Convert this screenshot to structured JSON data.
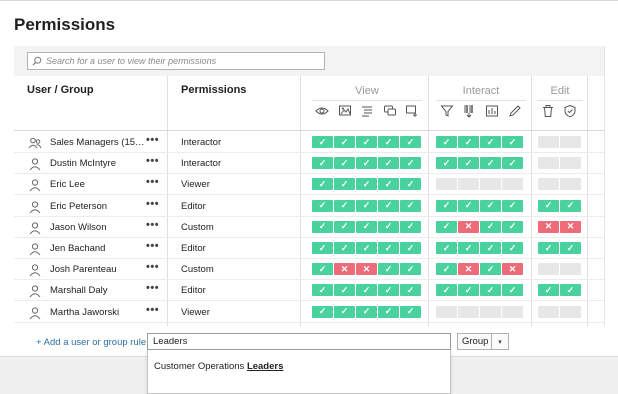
{
  "title": "Permissions",
  "search": {
    "placeholder": "Search for a user to view their permissions"
  },
  "headers": {
    "user_group": "User / Group",
    "permissions": "Permissions"
  },
  "capability_groups": [
    {
      "label": "View",
      "icons": [
        "eye-icon",
        "image-icon",
        "list-icon",
        "comment-icon",
        "subscribe-icon"
      ]
    },
    {
      "label": "Interact",
      "icons": [
        "filter-icon",
        "barcode-icon",
        "chart-download-icon",
        "pencil-icon"
      ]
    },
    {
      "label": "Edit",
      "icons": [
        "trash-icon",
        "shield-check-icon"
      ]
    }
  ],
  "rows": [
    {
      "name": "Sales Managers (15…",
      "is_group": true,
      "role": "Interactor",
      "cells": [
        "a",
        "a",
        "a",
        "a",
        "a",
        "a",
        "a",
        "a",
        "a",
        "n",
        "n"
      ]
    },
    {
      "name": "Dustin McIntyre",
      "is_group": false,
      "role": "Interactor",
      "cells": [
        "a",
        "a",
        "a",
        "a",
        "a",
        "a",
        "a",
        "a",
        "a",
        "n",
        "n"
      ]
    },
    {
      "name": "Eric Lee",
      "is_group": false,
      "role": "Viewer",
      "cells": [
        "a",
        "a",
        "a",
        "a",
        "a",
        "n",
        "n",
        "n",
        "n",
        "n",
        "n"
      ]
    },
    {
      "name": "Eric Peterson",
      "is_group": false,
      "role": "Editor",
      "cells": [
        "a",
        "a",
        "a",
        "a",
        "a",
        "a",
        "a",
        "a",
        "a",
        "a",
        "a"
      ]
    },
    {
      "name": "Jason Wilson",
      "is_group": false,
      "role": "Custom",
      "cells": [
        "a",
        "a",
        "a",
        "a",
        "a",
        "a",
        "d",
        "a",
        "a",
        "d",
        "d"
      ]
    },
    {
      "name": "Jen Bachand",
      "is_group": false,
      "role": "Editor",
      "cells": [
        "a",
        "a",
        "a",
        "a",
        "a",
        "a",
        "a",
        "a",
        "a",
        "a",
        "a"
      ]
    },
    {
      "name": "Josh Parenteau",
      "is_group": false,
      "role": "Custom",
      "cells": [
        "a",
        "d",
        "d",
        "a",
        "a",
        "a",
        "d",
        "a",
        "d",
        "n",
        "n"
      ]
    },
    {
      "name": "Marshall Daly",
      "is_group": false,
      "role": "Editor",
      "cells": [
        "a",
        "a",
        "a",
        "a",
        "a",
        "a",
        "a",
        "a",
        "a",
        "a",
        "a"
      ]
    },
    {
      "name": "Martha Jaworski",
      "is_group": false,
      "role": "Viewer",
      "cells": [
        "a",
        "a",
        "a",
        "a",
        "a",
        "n",
        "n",
        "n",
        "n",
        "n",
        "n"
      ]
    }
  ],
  "add_rule": {
    "link_label": "+ Add a user or group rule",
    "input_value": "Leaders",
    "type_selected": "Group",
    "caret": "▾"
  },
  "dropdown": {
    "option_prefix": "Customer Operations ",
    "option_match": "Leaders"
  },
  "symbols": {
    "allow": "✓",
    "deny": "✕",
    "more": "•••"
  },
  "colors": {
    "allow": "#49d29e",
    "deny": "#ee6b7a",
    "none": "#e7e7e7",
    "link": "#2c6fa7"
  }
}
